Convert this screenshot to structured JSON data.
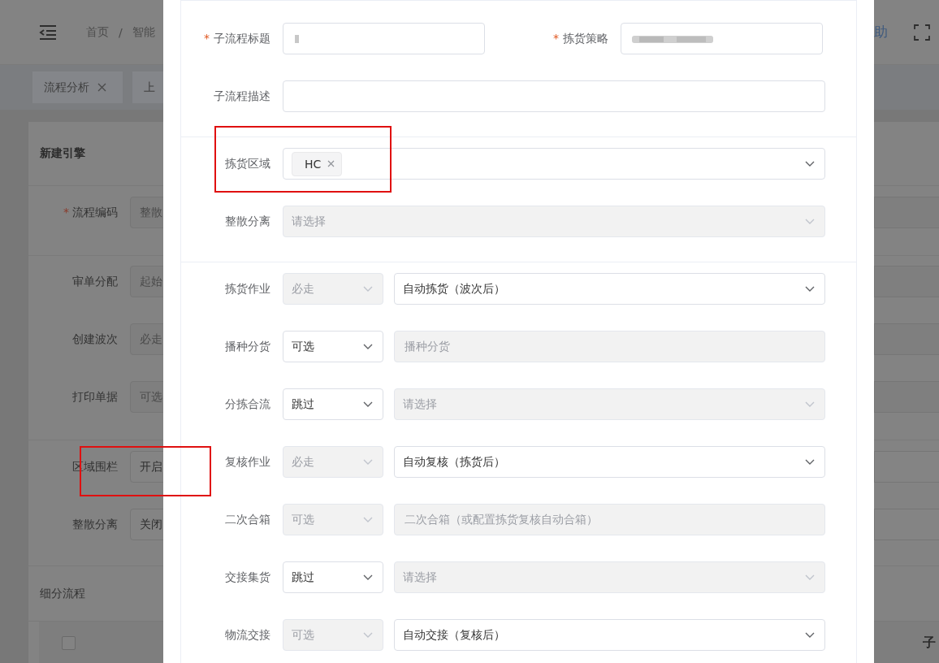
{
  "header": {
    "breadcrumb": [
      "首页",
      "智能"
    ],
    "separator": "/",
    "help_link": "助"
  },
  "tabs": [
    {
      "label": "流程分析",
      "closable": true
    },
    {
      "label": "上",
      "closable": false
    }
  ],
  "engine_form": {
    "title": "新建引擎",
    "sections": [
      [
        {
          "label": "流程编码",
          "required": true,
          "value": "整散",
          "disabled": true,
          "highlighted": false
        }
      ],
      [
        {
          "label": "审单分配",
          "required": false,
          "value": "起始",
          "disabled": true,
          "highlighted": false
        },
        {
          "label": "创建波次",
          "required": false,
          "value": "必走",
          "disabled": true,
          "highlighted": false
        },
        {
          "label": "打印单据",
          "required": false,
          "value": "可选",
          "disabled": true,
          "highlighted": false
        }
      ],
      [
        {
          "label": "区域围栏",
          "required": false,
          "value": "开启",
          "disabled": false,
          "highlighted": true
        },
        {
          "label": "整散分离",
          "required": false,
          "value": "关闭",
          "disabled": false,
          "highlighted": false
        }
      ]
    ],
    "subflow_title": "细分流程",
    "select_all": {
      "checked": false
    },
    "table_column": "子",
    "required_mark": "*"
  },
  "dialog": {
    "required_mark": "*",
    "title_field": {
      "label": "子流程标题",
      "required": true
    },
    "strategy_field": {
      "label": "拣货策略",
      "required": true
    },
    "description_field": {
      "label": "子流程描述",
      "required": false
    },
    "area_field": {
      "label": "拣货区域",
      "tags": [
        "HC"
      ],
      "highlighted": true
    },
    "split_field": {
      "label": "整散分离",
      "placeholder": "请选择",
      "disabled": true
    },
    "steps": [
      {
        "label": "拣货作业",
        "mode": {
          "value": "必走",
          "disabled": true
        },
        "target": {
          "kind": "select",
          "value": "自动拣货（波次后）",
          "disabled": false
        }
      },
      {
        "label": "播种分货",
        "mode": {
          "value": "可选",
          "disabled": false
        },
        "target": {
          "kind": "input",
          "placeholder": "播种分货",
          "disabled": true
        }
      },
      {
        "label": "分拣合流",
        "mode": {
          "value": "跳过",
          "disabled": false
        },
        "target": {
          "kind": "select",
          "placeholder": "请选择",
          "disabled": true
        }
      },
      {
        "label": "复核作业",
        "mode": {
          "value": "必走",
          "disabled": true
        },
        "target": {
          "kind": "select",
          "value": "自动复核（拣货后）",
          "disabled": false
        }
      },
      {
        "label": "二次合箱",
        "mode": {
          "value": "可选",
          "disabled": true
        },
        "target": {
          "kind": "input",
          "placeholder": "二次合箱（或配置拣货复核自动合箱）",
          "disabled": true
        }
      },
      {
        "label": "交接集货",
        "mode": {
          "value": "跳过",
          "disabled": false
        },
        "target": {
          "kind": "select",
          "placeholder": "请选择",
          "disabled": true
        }
      },
      {
        "label": "物流交接",
        "mode": {
          "value": "可选",
          "disabled": true
        },
        "target": {
          "kind": "select",
          "value": "自动交接（复核后）",
          "disabled": false
        }
      }
    ]
  }
}
